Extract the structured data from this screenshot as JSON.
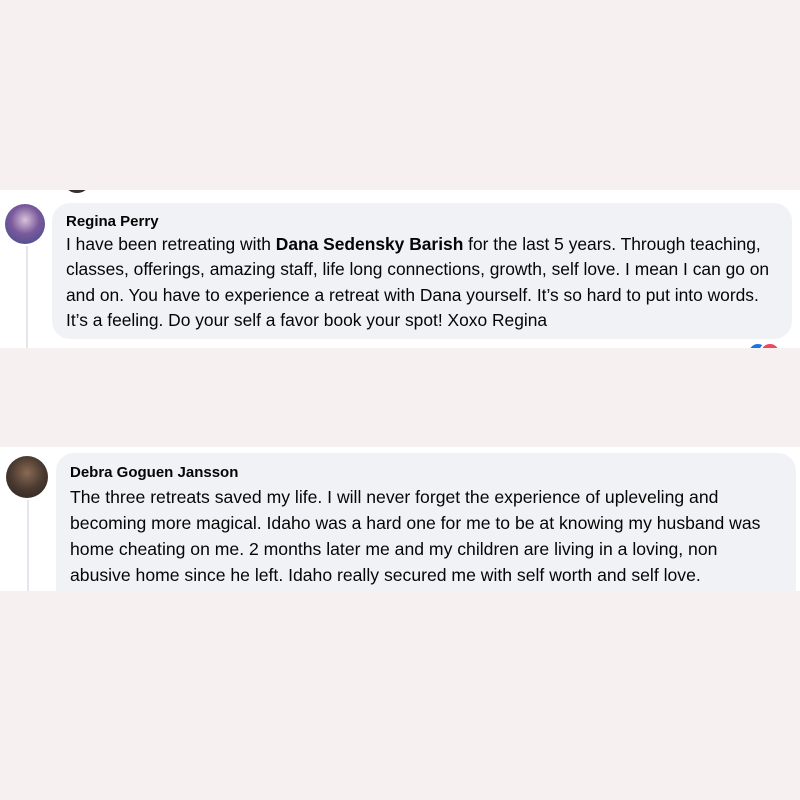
{
  "comments": [
    {
      "author": "Regina Perry",
      "text_before": "I have been retreating with ",
      "mention": "Dana Sedensky Barish",
      "text_after": " for the last 5 years. Through teaching, classes, offerings, amazing staff, life long connections, growth, self love. I mean I can go on and on. You have to experience a retreat with Dana yourself. It’s so hard to put into words. It’s a feeling. Do your self a favor book your spot! Xoxo Regina",
      "avatar_icon": "profile-photo",
      "reactions": [
        "like-icon",
        "love-icon"
      ]
    },
    {
      "author": "Debra Goguen Jansson",
      "text": "The three retreats saved my life. I will never forget the experience of upleveling and becoming more magical. Idaho was a hard one for me to be at knowing my husband was home cheating on me. 2 months later me and my children are living in a loving, non abusive home since he left. Idaho really secured me with self worth and self love.",
      "avatar_icon": "profile-photo"
    }
  ],
  "colors": {
    "page_background": "#f6f0f0",
    "bubble_background": "#f0f2f5",
    "like": "#1b74e4",
    "love": "#f0465f"
  }
}
